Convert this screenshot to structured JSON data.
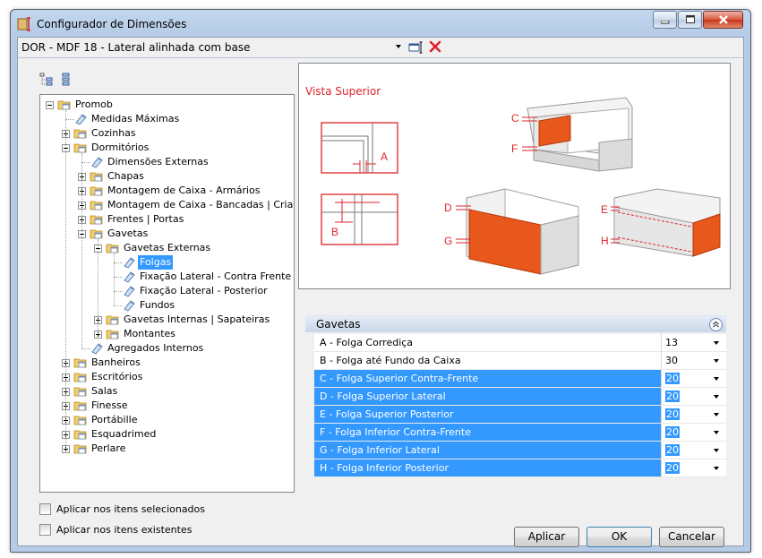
{
  "window": {
    "title": "Configurador de Dimensões",
    "controls": [
      "minimize-icon",
      "maximize-icon",
      "close-icon"
    ]
  },
  "config": {
    "selected": "DOR - MDF 18 - Lateral alinhada com base"
  },
  "tree": {
    "items": [
      {
        "label": "Promob",
        "level": 0,
        "icon": "folder-icon",
        "expander": "minus"
      },
      {
        "label": "Medidas Máximas",
        "level": 1,
        "icon": "tag-icon",
        "expander": "none"
      },
      {
        "label": "Cozinhas",
        "level": 1,
        "icon": "folder-icon",
        "expander": "plus"
      },
      {
        "label": "Dormitórios",
        "level": 1,
        "icon": "folder-icon",
        "expander": "minus"
      },
      {
        "label": "Dimensões Externas",
        "level": 2,
        "icon": "tag-icon",
        "expander": "none"
      },
      {
        "label": "Chapas",
        "level": 2,
        "icon": "folder-icon",
        "expander": "plus"
      },
      {
        "label": "Montagem de Caixa - Armários",
        "level": 2,
        "icon": "folder-icon",
        "expander": "plus"
      },
      {
        "label": "Montagem de Caixa - Bancadas | Criados",
        "level": 2,
        "icon": "folder-icon",
        "expander": "plus"
      },
      {
        "label": "Frentes | Portas",
        "level": 2,
        "icon": "folder-icon",
        "expander": "plus"
      },
      {
        "label": "Gavetas",
        "level": 2,
        "icon": "folder-icon",
        "expander": "minus"
      },
      {
        "label": "Gavetas Externas",
        "level": 3,
        "icon": "folder-icon",
        "expander": "minus"
      },
      {
        "label": "Folgas",
        "level": 4,
        "icon": "tag-icon",
        "expander": "none",
        "selected": true
      },
      {
        "label": "Fixação Lateral - Contra Frente",
        "level": 4,
        "icon": "tag-icon",
        "expander": "none"
      },
      {
        "label": "Fixação Lateral - Posterior",
        "level": 4,
        "icon": "tag-icon",
        "expander": "none"
      },
      {
        "label": "Fundos",
        "level": 4,
        "icon": "tag-icon",
        "expander": "none"
      },
      {
        "label": "Gavetas Internas | Sapateiras",
        "level": 3,
        "icon": "folder-icon",
        "expander": "plus"
      },
      {
        "label": "Montantes",
        "level": 3,
        "icon": "folder-icon",
        "expander": "plus"
      },
      {
        "label": "Agregados Internos",
        "level": 2,
        "icon": "tag-icon",
        "expander": "none"
      },
      {
        "label": "Banheiros",
        "level": 1,
        "icon": "folder-icon",
        "expander": "plus"
      },
      {
        "label": "Escritórios",
        "level": 1,
        "icon": "folder-icon",
        "expander": "plus"
      },
      {
        "label": "Salas",
        "level": 1,
        "icon": "folder-icon",
        "expander": "plus"
      },
      {
        "label": "Finesse",
        "level": 1,
        "icon": "folder-icon",
        "expander": "plus"
      },
      {
        "label": "Portábille",
        "level": 1,
        "icon": "folder-icon",
        "expander": "plus"
      },
      {
        "label": "Esquadrimed",
        "level": 1,
        "icon": "folder-icon",
        "expander": "plus"
      },
      {
        "label": "Perlare",
        "level": 1,
        "icon": "folder-icon",
        "expander": "plus"
      }
    ]
  },
  "options": {
    "apply_selected": "Aplicar nos itens selecionados",
    "apply_existing": "Aplicar nos itens existentes"
  },
  "preview": {
    "view_label": "Vista Superior",
    "letters": [
      "A",
      "B",
      "C",
      "D",
      "E",
      "F",
      "G",
      "H"
    ],
    "accent_color": "#e0242a",
    "panel_color": "#e8581c"
  },
  "properties": {
    "section_title": "Gavetas",
    "rows": [
      {
        "name": "A - Folga Corrediça",
        "value": "13",
        "highlight": false
      },
      {
        "name": "B - Folga até Fundo da Caixa",
        "value": "30",
        "highlight": false
      },
      {
        "name": "C - Folga Superior Contra-Frente",
        "value": "20",
        "highlight": true
      },
      {
        "name": "D - Folga Superior Lateral",
        "value": "20",
        "highlight": true
      },
      {
        "name": "E - Folga Superior Posterior",
        "value": "20",
        "highlight": true
      },
      {
        "name": "F - Folga Inferior Contra-Frente",
        "value": "20",
        "highlight": true
      },
      {
        "name": "G - Folga Inferior Lateral",
        "value": "20",
        "highlight": true
      },
      {
        "name": "H - Folga Inferior Posterior",
        "value": "20",
        "highlight": true
      }
    ],
    "highlight_color": "#3399ff"
  },
  "buttons": {
    "apply": "Aplicar",
    "ok": "OK",
    "cancel": "Cancelar"
  }
}
